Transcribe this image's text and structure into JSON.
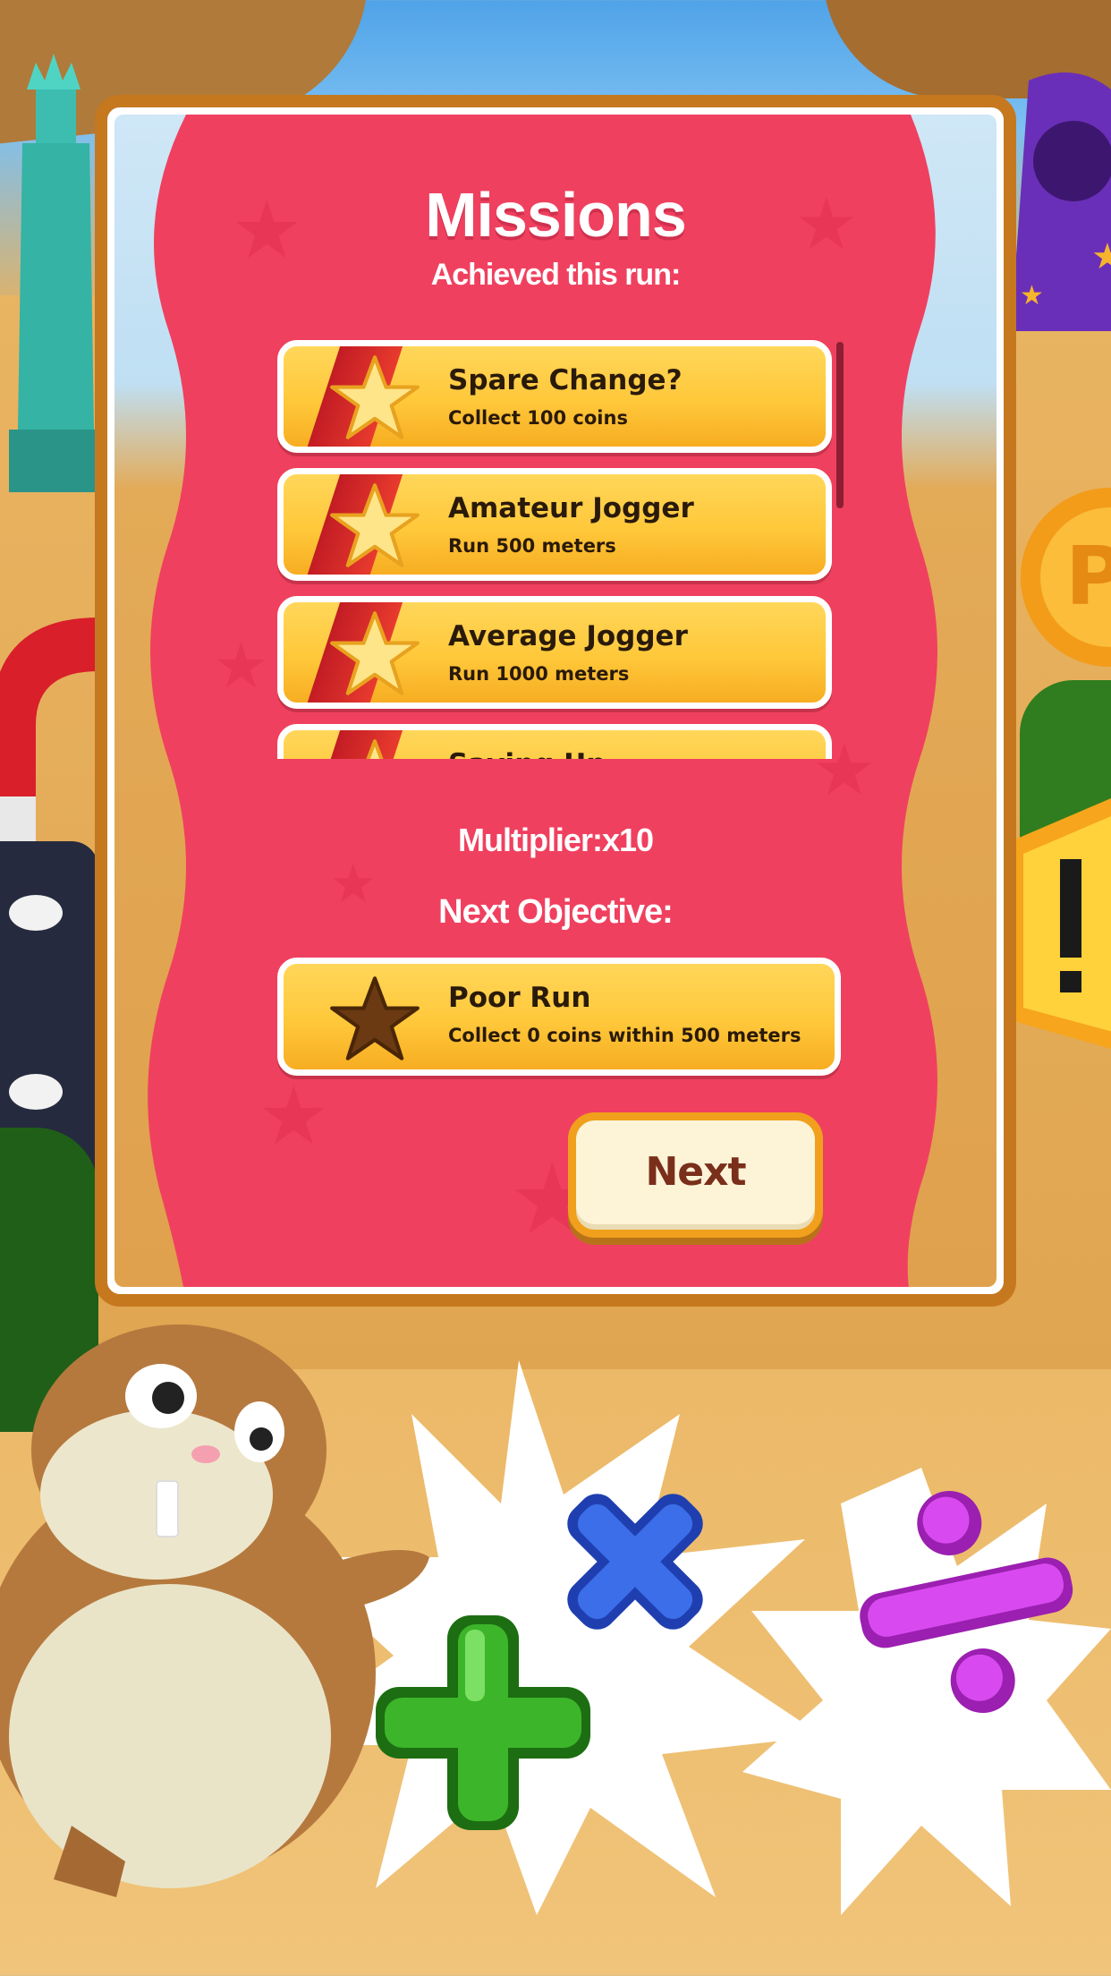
{
  "panel": {
    "title": "Missions",
    "achieved_label": "Achieved this run:",
    "multiplier_label": "Multiplier:x10",
    "next_objective_label": "Next Objective:"
  },
  "missions": [
    {
      "title": "Spare Change?",
      "subtitle": "Collect 100 coins",
      "icon": "star-ribbon-icon"
    },
    {
      "title": "Amateur Jogger",
      "subtitle": "Run 500 meters",
      "icon": "star-ribbon-icon"
    },
    {
      "title": "Average Jogger",
      "subtitle": "Run 1000 meters",
      "icon": "star-ribbon-icon"
    },
    {
      "title": "Saving Up",
      "subtitle": "",
      "icon": "star-ribbon-icon"
    }
  ],
  "next_objective": {
    "title": "Poor Run",
    "subtitle": "Collect 0 coins within 500 meters",
    "icon": "dark-star-icon"
  },
  "buttons": {
    "next_label": "Next"
  },
  "colors": {
    "panel_pink": "#f0405f",
    "card_gold": "#ffc83a",
    "frame_brown": "#c6781f",
    "button_cream": "#fdf4d8",
    "button_text": "#7a2f1a"
  },
  "decorations": [
    "hamster-mascot",
    "plus-icon",
    "multiply-icon",
    "divide-icon"
  ]
}
